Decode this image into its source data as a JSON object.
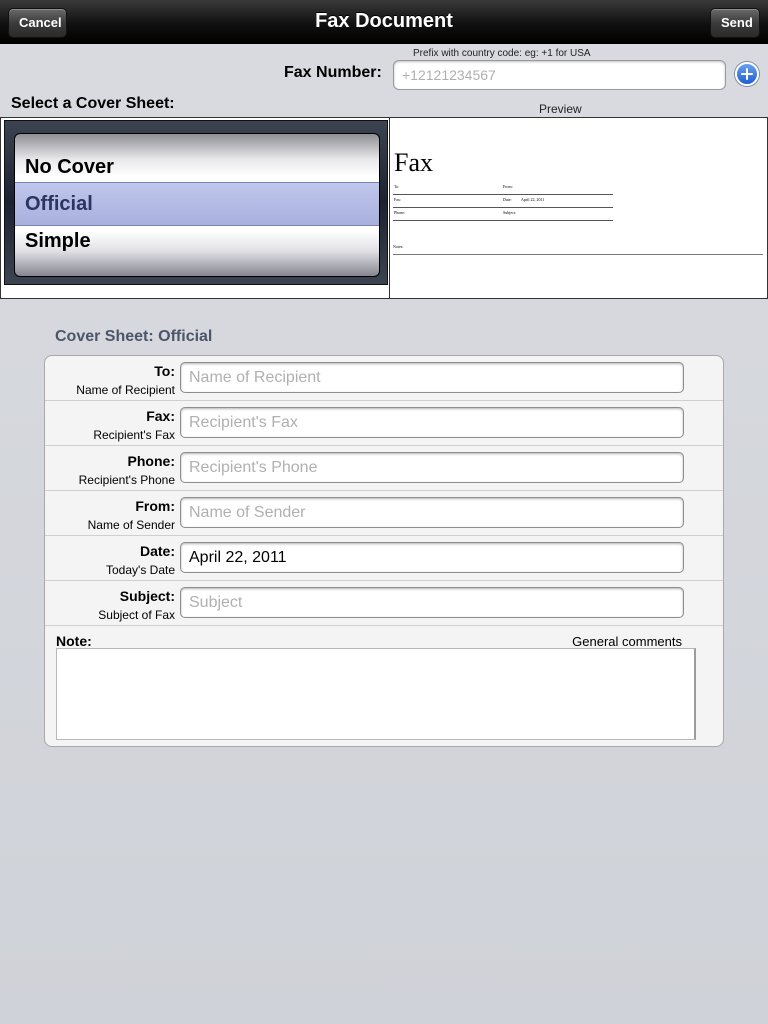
{
  "navbar": {
    "title": "Fax Document",
    "cancel_label": "Cancel",
    "send_label": "Send"
  },
  "fax_number": {
    "hint": "Prefix with country code: eg: +1 for USA",
    "label": "Fax Number:",
    "placeholder": "+12121234567",
    "value": ""
  },
  "cover_picker": {
    "label": "Select a Cover Sheet:",
    "options": [
      "No Cover",
      "Official",
      "Simple"
    ],
    "selected": "Official"
  },
  "preview": {
    "label": "Preview",
    "title": "Fax",
    "rows": [
      {
        "left": "To:",
        "right": "From:",
        "right_value": ""
      },
      {
        "left": "Fax:",
        "right": "Date:",
        "right_value": "April 22, 2011"
      },
      {
        "left": "Phone:",
        "right": "Subject:",
        "right_value": ""
      }
    ],
    "notes_label": "Notes:"
  },
  "cover_sheet": {
    "title": "Cover Sheet: Official",
    "fields": [
      {
        "label": "To:",
        "sub": "Name of Recipient",
        "placeholder": "Name of Recipient",
        "value": ""
      },
      {
        "label": "Fax:",
        "sub": "Recipient's Fax",
        "placeholder": "Recipient's Fax",
        "value": ""
      },
      {
        "label": "Phone:",
        "sub": "Recipient's Phone",
        "placeholder": "Recipient's Phone",
        "value": ""
      },
      {
        "label": "From:",
        "sub": "Name of Sender",
        "placeholder": "Name of Sender",
        "value": ""
      },
      {
        "label": "Date:",
        "sub": "Today's Date",
        "placeholder": "",
        "value": "April 22, 2011"
      },
      {
        "label": "Subject:",
        "sub": "Subject of Fax",
        "placeholder": "Subject",
        "value": ""
      }
    ],
    "note_label": "Note:",
    "note_hint": "General comments",
    "note_value": ""
  },
  "icons": {
    "add": "plus-circle-icon"
  },
  "colors": {
    "navbar": "#111111",
    "section_title": "#4c566a",
    "picker_selection": "#aab4e6",
    "add_button": "#1f5fd0"
  }
}
